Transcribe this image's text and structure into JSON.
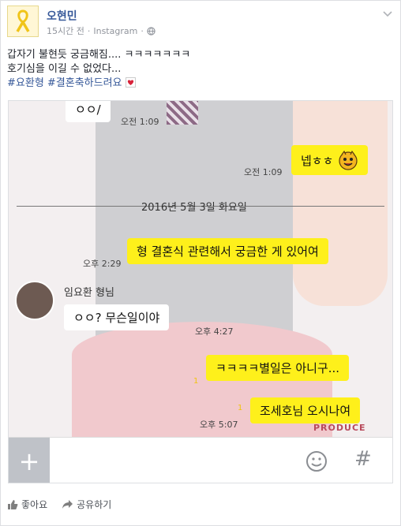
{
  "post": {
    "author": "오현민",
    "time": "15시간 전",
    "source": "Instagram",
    "line1": "갑자기 불현듯 궁금해짐.... ㅋㅋㅋㅋㅋㅋㅋ",
    "line2": "호기심을 이길 수 없었다...",
    "hashtags": "#요환형 #결혼축하드려요"
  },
  "chat": {
    "msg1": "ㅇㅇ/",
    "msg1_time": "오전 1:09",
    "msg2": "넵ㅎㅎ",
    "msg2_time": "오전 1:09",
    "date": "2016년 5월 3일 화요일",
    "msg3": "형 결혼식 관련해서 궁금한 게 있어여",
    "msg3_time": "오후 2:29",
    "friend_name": "임요환 형님",
    "msg4": "ㅇㅇ? 무슨일이야",
    "msg4_time": "오후 4:27",
    "msg5": "ㅋㅋㅋㅋ별일은 아니구...",
    "msg5_unread": "1",
    "msg6": "조세호님 오시나여",
    "msg6_unread": "1",
    "msg6_time": "오후 5:07",
    "watermark": "PRODUCE",
    "plus": "+",
    "hash": "#"
  },
  "actions": {
    "like": "좋아요",
    "share": "공유하기"
  },
  "colors": {
    "link": "#365899",
    "bubble_yellow": "#fef01b"
  }
}
